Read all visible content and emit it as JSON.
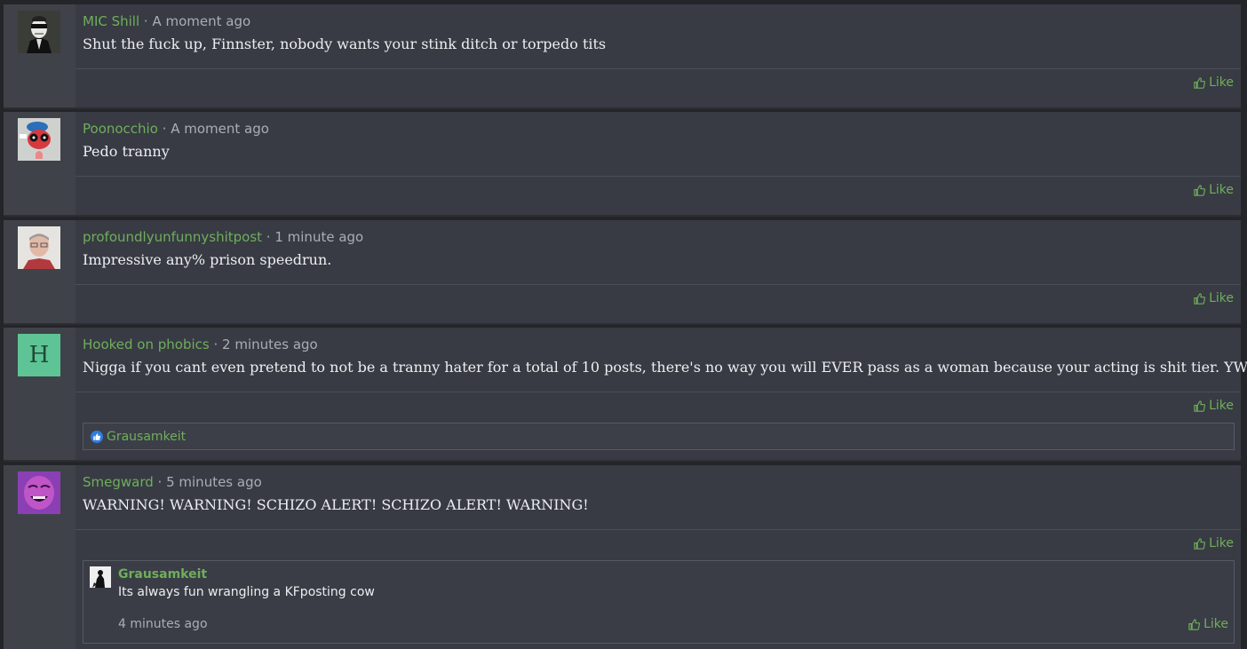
{
  "colors": {
    "accent": "#6fae5c",
    "background": "#383b43",
    "gutter": "#3f4249",
    "text": "#eceef1",
    "muted": "#a9adb5"
  },
  "posts": [
    {
      "username": "MIC Shill",
      "separator": " · ",
      "time": "A moment ago",
      "text": "Shut the fuck up, Finnster, nobody wants your stink ditch or torpedo tits",
      "like_label": "Like"
    },
    {
      "username": "Poonocchio",
      "separator": " · ",
      "time": "A moment ago",
      "text": "Pedo tranny",
      "like_label": "Like"
    },
    {
      "username": "profoundlyunfunnyshitpost",
      "separator": " · ",
      "time": "1 minute ago",
      "text": "Impressive any% prison speedrun.",
      "like_label": "Like"
    },
    {
      "username": "Hooked on phobics",
      "avatar_letter": "H",
      "separator": " · ",
      "time": "2 minutes ago",
      "text": "Nigga if you cant even pretend to not be a tranny hater for a total of 10 posts, there's no way you will EVER pass as a woman because your acting is shit tier. YWNBAW",
      "like_label": "Like",
      "liked_by": "Grausamkeit"
    },
    {
      "username": "Smegward",
      "separator": " · ",
      "time": "5 minutes ago",
      "text": "WARNING! WARNING! SCHIZO ALERT! SCHIZO ALERT! WARNING!",
      "like_label": "Like",
      "reply": {
        "username": "Grausamkeit",
        "text": "Its always fun wrangling a KFposting cow",
        "time": "4 minutes ago",
        "like_label": "Like"
      }
    }
  ]
}
